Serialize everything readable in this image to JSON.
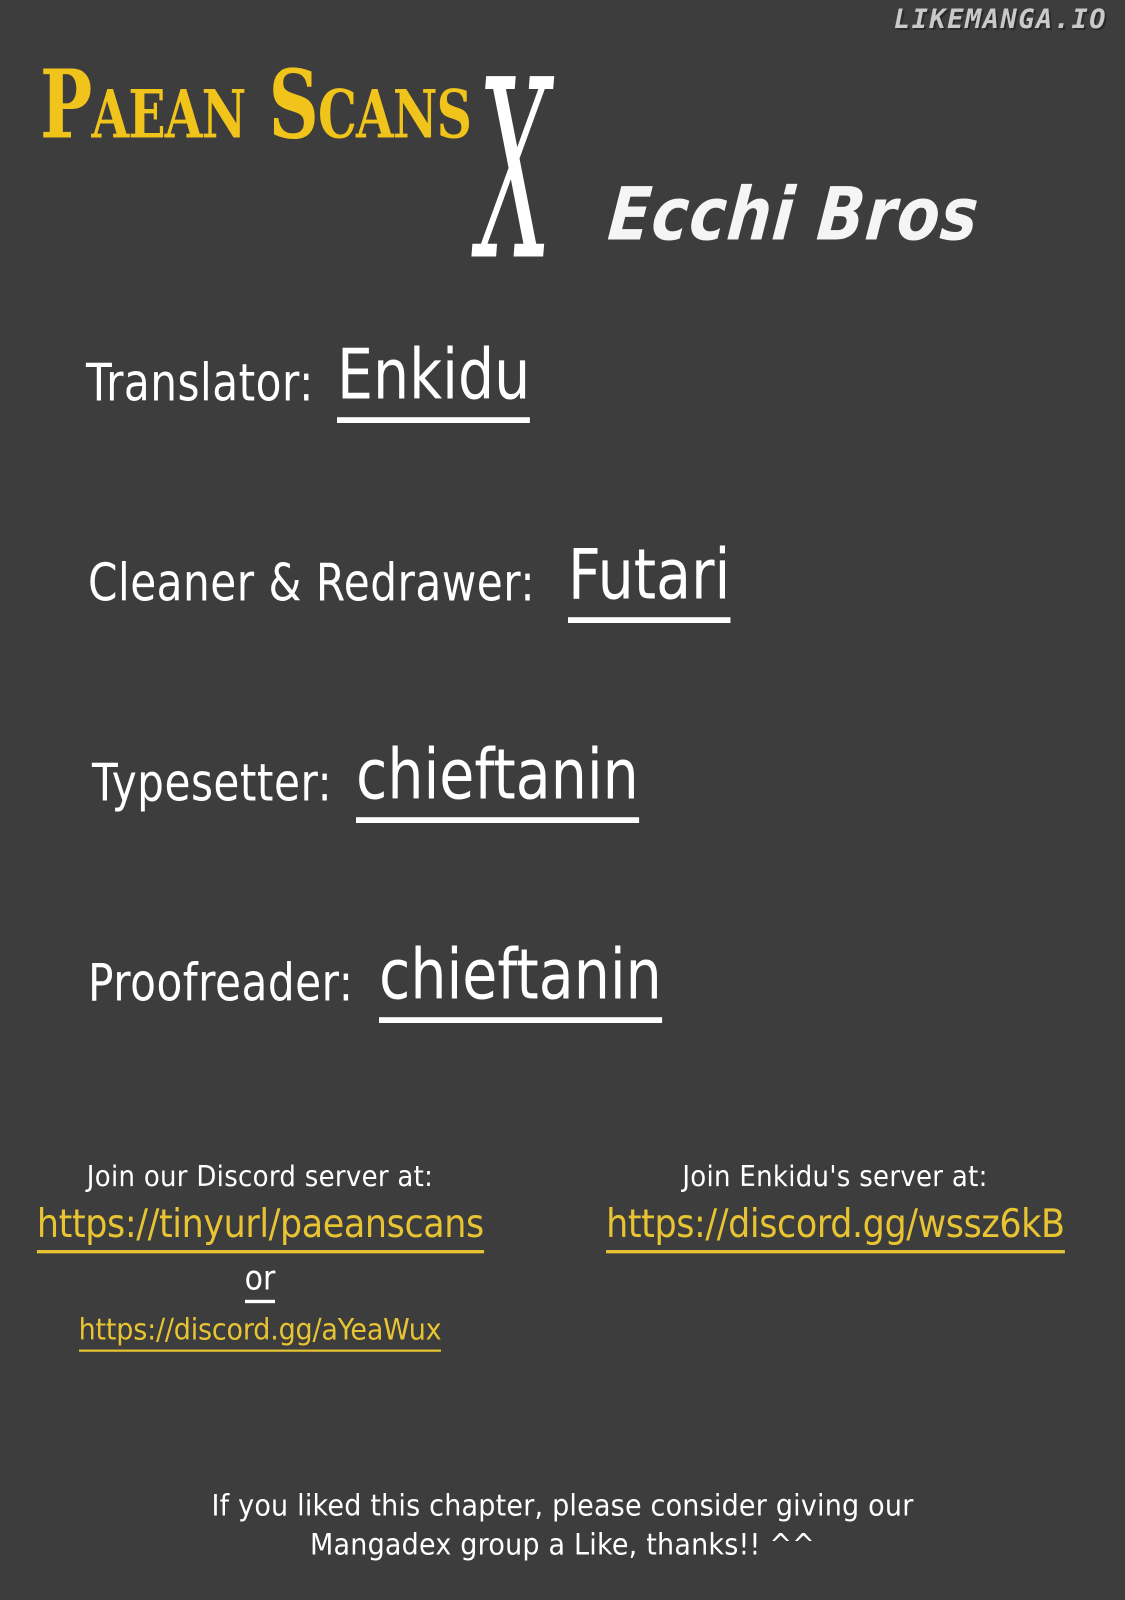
{
  "watermark": {
    "text": "LIKEMANGA.IO"
  },
  "header": {
    "group_primary": "Paean Scans",
    "separator": "X",
    "group_secondary": "Ecchi Bros"
  },
  "credits": [
    {
      "label": "Translator:",
      "value": "Enkidu"
    },
    {
      "label": "Cleaner & Redrawer:",
      "value": "Futari"
    },
    {
      "label": "Typesetter:",
      "value": "chieftanin"
    },
    {
      "label": "Proofreader:",
      "value": "chieftanin"
    }
  ],
  "discord": {
    "left": {
      "heading": "Join our Discord server at:",
      "link_primary": "https://tinyurl/paeanscans",
      "separator": "or",
      "link_secondary": "https://discord.gg/aYeaWux"
    },
    "right": {
      "heading": "Join Enkidu's server at:",
      "link_primary": "https://discord.gg/wssz6kB"
    }
  },
  "footer": {
    "line1": "If you liked this chapter, please consider giving our",
    "line2": "Mangadex group a Like, thanks!! ^^"
  },
  "colors": {
    "background": "#3d3d3d",
    "accent_yellow": "#e8c432",
    "logo_yellow": "#f0c41a",
    "text_white": "#ffffff",
    "watermark_gray": "#c9c9c9"
  }
}
